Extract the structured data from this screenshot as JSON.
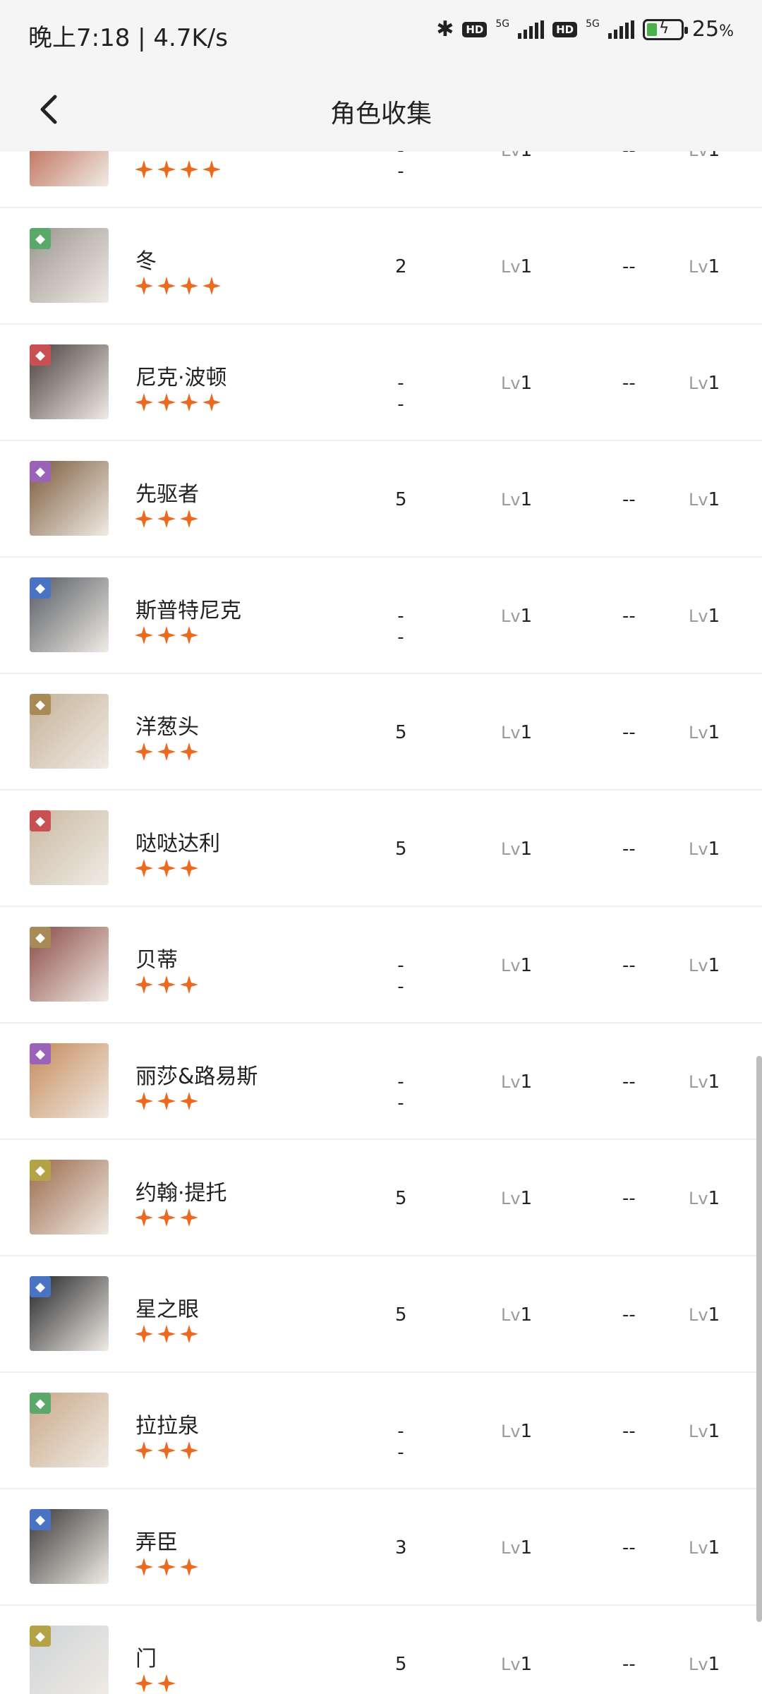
{
  "status": {
    "time_speed": "晚上7:18 | 4.7K/s",
    "network_1": "5G",
    "network_2": "5G",
    "hd_1": "HD",
    "hd_2": "HD",
    "battery_value": "25",
    "battery_unit": "%",
    "battery_level": 0.25
  },
  "header": {
    "title": "角色收集"
  },
  "columns_note": "",
  "rows": [
    {
      "name": "",
      "stars": 4,
      "count": "--",
      "lv_prefix": "Lv",
      "lv1": "1",
      "dash": "--",
      "lv2": "1",
      "badge_color": "#c23b3b",
      "avatar_color": "#b5523b"
    },
    {
      "name": "冬",
      "stars": 4,
      "count": "2",
      "lv_prefix": "Lv",
      "lv1": "1",
      "dash": "--",
      "lv2": "1",
      "badge_color": "#5aa86a",
      "avatar_color": "#9b9590"
    },
    {
      "name": "尼克·波顿",
      "stars": 4,
      "count": "--",
      "lv_prefix": "Lv",
      "lv1": "1",
      "dash": "--",
      "lv2": "1",
      "badge_color": "#c85052",
      "avatar_color": "#4a4040"
    },
    {
      "name": "先驱者",
      "stars": 3,
      "count": "5",
      "lv_prefix": "Lv",
      "lv1": "1",
      "dash": "--",
      "lv2": "1",
      "badge_color": "#9b62b9",
      "avatar_color": "#7a5a3a"
    },
    {
      "name": "斯普特尼克",
      "stars": 3,
      "count": "--",
      "lv_prefix": "Lv",
      "lv1": "1",
      "dash": "--",
      "lv2": "1",
      "badge_color": "#4a73c4",
      "avatar_color": "#555a62"
    },
    {
      "name": "洋葱头",
      "stars": 3,
      "count": "5",
      "lv_prefix": "Lv",
      "lv1": "1",
      "dash": "--",
      "lv2": "1",
      "badge_color": "#a88a56",
      "avatar_color": "#c4b096"
    },
    {
      "name": "哒哒达利",
      "stars": 3,
      "count": "5",
      "lv_prefix": "Lv",
      "lv1": "1",
      "dash": "--",
      "lv2": "1",
      "badge_color": "#c85052",
      "avatar_color": "#c9b9a2"
    },
    {
      "name": "贝蒂",
      "stars": 3,
      "count": "--",
      "lv_prefix": "Lv",
      "lv1": "1",
      "dash": "--",
      "lv2": "1",
      "badge_color": "#a88a56",
      "avatar_color": "#8a4a44"
    },
    {
      "name": "丽莎&路易斯",
      "stars": 3,
      "count": "--",
      "lv_prefix": "Lv",
      "lv1": "1",
      "dash": "--",
      "lv2": "1",
      "badge_color": "#9b62b9",
      "avatar_color": "#c48a5a"
    },
    {
      "name": "约翰·提托",
      "stars": 3,
      "count": "5",
      "lv_prefix": "Lv",
      "lv1": "1",
      "dash": "--",
      "lv2": "1",
      "badge_color": "#b3a246",
      "avatar_color": "#9a6a4a"
    },
    {
      "name": "星之眼",
      "stars": 3,
      "count": "5",
      "lv_prefix": "Lv",
      "lv1": "1",
      "dash": "--",
      "lv2": "1",
      "badge_color": "#4a73c4",
      "avatar_color": "#222428"
    },
    {
      "name": "拉拉泉",
      "stars": 3,
      "count": "--",
      "lv_prefix": "Lv",
      "lv1": "1",
      "dash": "--",
      "lv2": "1",
      "badge_color": "#5aa86a",
      "avatar_color": "#c9a888"
    },
    {
      "name": "弄臣",
      "stars": 3,
      "count": "3",
      "lv_prefix": "Lv",
      "lv1": "1",
      "dash": "--",
      "lv2": "1",
      "badge_color": "#4a73c4",
      "avatar_color": "#3a3a3a"
    },
    {
      "name": "门",
      "stars": 2,
      "count": "5",
      "lv_prefix": "Lv",
      "lv1": "1",
      "dash": "--",
      "lv2": "1",
      "badge_color": "#b3a246",
      "avatar_color": "#cfd3d8"
    }
  ],
  "colors": {
    "star": "#ea6a1f",
    "divider": "#eeeeee",
    "header_bg": "#f5f5f5"
  }
}
